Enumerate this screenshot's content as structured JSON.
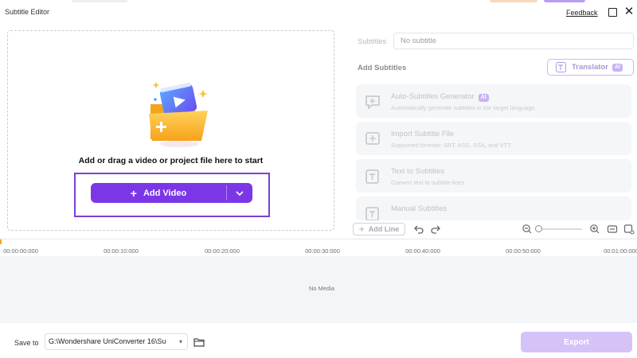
{
  "window": {
    "title": "Subtitle Editor",
    "feedback": "Feedback",
    "close_glyph": "✕"
  },
  "dropzone": {
    "instruction": "Add or drag a video or project file here to start",
    "add_video_label": "Add Video",
    "add_video_plus": "+",
    "illustration_icon": "video-folder-icon"
  },
  "subtitles_panel": {
    "subtitles_label": "Subtitles",
    "subtitle_select_value": "No subtitle",
    "add_subtitles_heading": "Add Subtitles",
    "translator_label": "Translator",
    "ai_badge": "AI",
    "options": [
      {
        "title": "Auto-Subtitles Generator",
        "desc": "Automatically generate subtitles in the target language.",
        "icon": "auto-subtitle-icon",
        "badge": "AI"
      },
      {
        "title": "Import Subtitle File",
        "desc": "Supported formats: SRT, ASS, SSA, and VTT.",
        "icon": "import-subtitle-icon"
      },
      {
        "title": "Text to Subtitles",
        "desc": "Convert text to subtitle lines.",
        "icon": "text-to-subtitle-icon"
      },
      {
        "title": "Manual Subtitles",
        "desc": "",
        "icon": "manual-subtitle-icon"
      }
    ]
  },
  "toolbar": {
    "add_line_label": "Add Line",
    "add_line_plus": "+",
    "icons": [
      "undo-icon",
      "redo-icon",
      "zoom-out-icon",
      "zoom-in-icon",
      "fit-icon",
      "settings-icon"
    ]
  },
  "timeline": {
    "ticks": [
      "00:00:00:000",
      "00:00:10:000",
      "00:00:20:000",
      "00:00:30:000",
      "00:00:40:000",
      "00:00:50:000",
      "00:01:00:000"
    ],
    "empty_text": "No Media"
  },
  "footer": {
    "save_to_label": "Save to",
    "save_path": "G:\\Wondershare UniConverter 16\\Su",
    "export_label": "Export"
  },
  "colors": {
    "accent": "#7b36e8",
    "highlight_border": "#7a3fd6",
    "export_disabled": "#d5c3f7"
  }
}
